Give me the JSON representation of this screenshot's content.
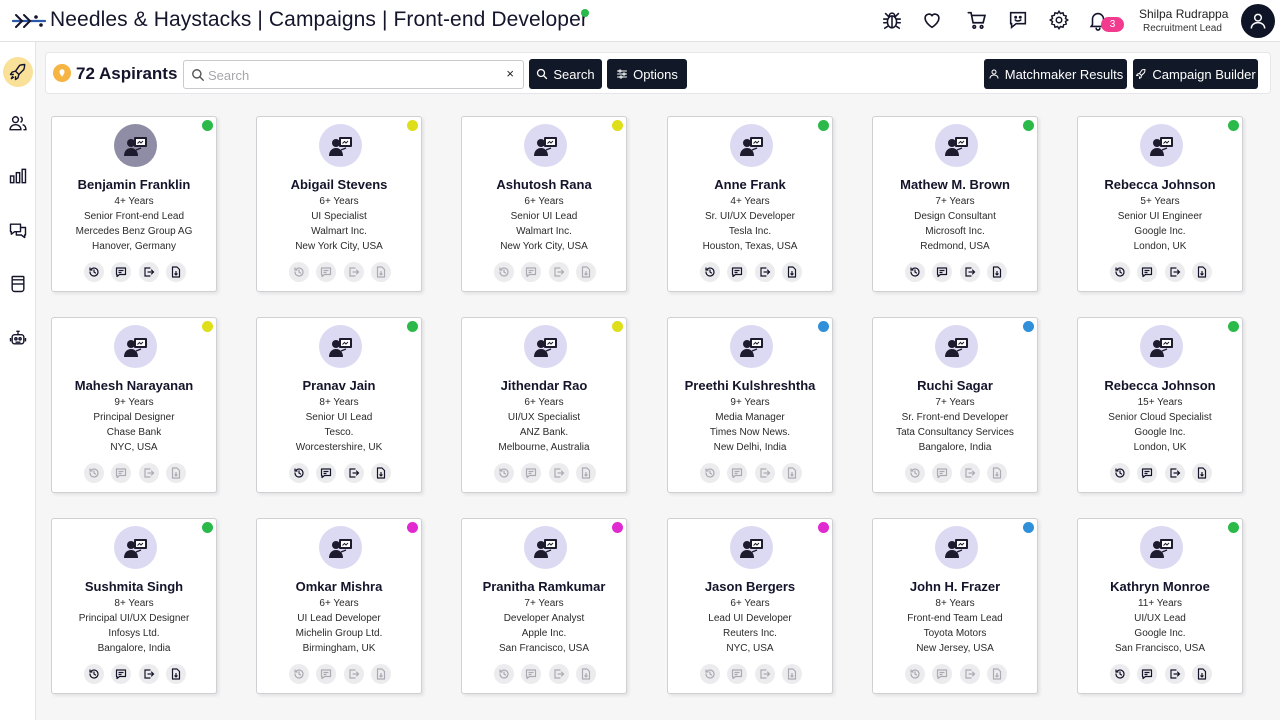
{
  "header": {
    "title": "Needles & Haystacks | Campaigns | Front-end Developer",
    "logo_icon": "needle-logo-icon",
    "icons": [
      "bug-icon",
      "heart-icon",
      "cart-icon",
      "feedback-icon",
      "gear-icon",
      "bell-icon"
    ],
    "notification_count": "3",
    "user_name": "Shilpa Rudrappa",
    "user_role": "Recruitment Lead",
    "avatar_icon": "user-icon"
  },
  "sidebar": {
    "items": [
      {
        "icon": "rocket-icon",
        "active": true
      },
      {
        "icon": "users-icon",
        "active": false
      },
      {
        "icon": "bar-chart-icon",
        "active": false
      },
      {
        "icon": "chat-icon",
        "active": false
      },
      {
        "icon": "jar-icon",
        "active": false
      },
      {
        "icon": "robot-icon",
        "active": false
      }
    ]
  },
  "toolbar": {
    "count_label": "72 Aspirants",
    "search_placeholder": "Search",
    "search_value": "",
    "clear_label": "×",
    "search_button": "Search",
    "options_button": "Options",
    "matchmaker_button": "Matchmaker Results",
    "campaign_button": "Campaign Builder"
  },
  "colors": {
    "accent_dark": "#111827",
    "status_green": "#2bb94a",
    "status_yellow": "#dede1a",
    "status_blue": "#2f8fd8",
    "status_magenta": "#e02ad0",
    "avatar_bg": "#dcdaf3",
    "badge": "#f23a8e"
  },
  "cards": [
    {
      "name": "Benjamin Franklin",
      "years": "4+ Years",
      "role": "Senior Front-end Lead",
      "company": "Mercedes Benz Group AG",
      "location": "Hanover, Germany",
      "status": "green",
      "actions_enabled": true,
      "avatar_filled": true
    },
    {
      "name": "Abigail Stevens",
      "years": "6+ Years",
      "role": "UI Specialist",
      "company": "Walmart Inc.",
      "location": "New York City, USA",
      "status": "yellow",
      "actions_enabled": false,
      "avatar_filled": false
    },
    {
      "name": "Ashutosh Rana",
      "years": "6+ Years",
      "role": "Senior UI Lead",
      "company": "Walmart Inc.",
      "location": "New York City, USA",
      "status": "yellow",
      "actions_enabled": false,
      "avatar_filled": false
    },
    {
      "name": "Anne Frank",
      "years": "4+ Years",
      "role": "Sr. UI/UX Developer",
      "company": "Tesla Inc.",
      "location": "Houston, Texas, USA",
      "status": "green",
      "actions_enabled": true,
      "avatar_filled": false
    },
    {
      "name": "Mathew M. Brown",
      "years": "7+ Years",
      "role": "Design Consultant",
      "company": "Microsoft Inc.",
      "location": "Redmond, USA",
      "status": "green",
      "actions_enabled": true,
      "avatar_filled": false
    },
    {
      "name": "Rebecca Johnson",
      "years": "5+ Years",
      "role": "Senior UI Engineer",
      "company": "Google Inc.",
      "location": "London, UK",
      "status": "green",
      "actions_enabled": true,
      "avatar_filled": false
    },
    {
      "name": "Mahesh Narayanan",
      "years": "9+ Years",
      "role": "Principal Designer",
      "company": "Chase Bank",
      "location": "NYC, USA",
      "status": "yellow",
      "actions_enabled": false,
      "avatar_filled": false
    },
    {
      "name": "Pranav Jain",
      "years": "8+ Years",
      "role": "Senior UI Lead",
      "company": "Tesco.",
      "location": "Worcestershire, UK",
      "status": "green",
      "actions_enabled": true,
      "avatar_filled": false
    },
    {
      "name": "Jithendar Rao",
      "years": "6+ Years",
      "role": "UI/UX Specialist",
      "company": "ANZ Bank.",
      "location": "Melbourne, Australia",
      "status": "yellow",
      "actions_enabled": false,
      "avatar_filled": false
    },
    {
      "name": "Preethi Kulshreshtha",
      "years": "9+ Years",
      "role": "Media Manager",
      "company": "Times Now News.",
      "location": "New Delhi, India",
      "status": "blue",
      "actions_enabled": false,
      "avatar_filled": false
    },
    {
      "name": "Ruchi Sagar",
      "years": "7+ Years",
      "role": "Sr. Front-end Developer",
      "company": "Tata Consultancy Services",
      "location": "Bangalore, India",
      "status": "blue",
      "actions_enabled": false,
      "avatar_filled": false
    },
    {
      "name": "Rebecca Johnson",
      "years": "15+ Years",
      "role": "Senior Cloud Specialist",
      "company": "Google Inc.",
      "location": "London, UK",
      "status": "green",
      "actions_enabled": true,
      "avatar_filled": false
    },
    {
      "name": "Sushmita Singh",
      "years": "8+ Years",
      "role": "Principal UI/UX Designer",
      "company": "Infosys Ltd.",
      "location": "Bangalore, India",
      "status": "green",
      "actions_enabled": true,
      "avatar_filled": false
    },
    {
      "name": "Omkar Mishra",
      "years": "6+ Years",
      "role": "UI Lead Developer",
      "company": "Michelin Group Ltd.",
      "location": "Birmingham, UK",
      "status": "magenta",
      "actions_enabled": false,
      "avatar_filled": false
    },
    {
      "name": "Pranitha Ramkumar",
      "years": "7+ Years",
      "role": "Developer Analyst",
      "company": "Apple Inc.",
      "location": "San Francisco, USA",
      "status": "magenta",
      "actions_enabled": false,
      "avatar_filled": false
    },
    {
      "name": "Jason Bergers",
      "years": "6+ Years",
      "role": "Lead UI Developer",
      "company": "Reuters Inc.",
      "location": "NYC, USA",
      "status": "magenta",
      "actions_enabled": false,
      "avatar_filled": false
    },
    {
      "name": "John H. Frazer",
      "years": "8+ Years",
      "role": "Front-end Team Lead",
      "company": "Toyota Motors",
      "location": "New Jersey, USA",
      "status": "blue",
      "actions_enabled": false,
      "avatar_filled": false
    },
    {
      "name": "Kathryn Monroe",
      "years": "11+ Years",
      "role": "UI/UX Lead",
      "company": "Google Inc.",
      "location": "San Francisco, USA",
      "status": "green",
      "actions_enabled": true,
      "avatar_filled": false
    }
  ],
  "card_action_icons": [
    "history-icon",
    "message-icon",
    "export-icon",
    "download-file-icon"
  ]
}
